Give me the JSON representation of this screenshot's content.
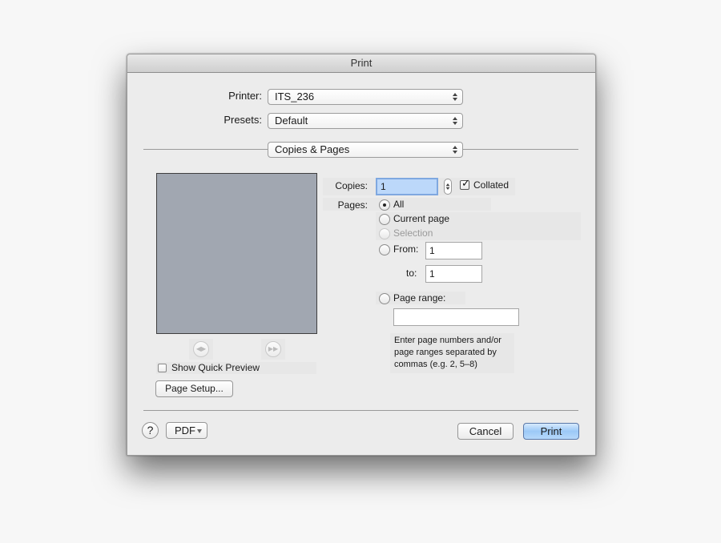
{
  "window": {
    "title": "Print"
  },
  "printer": {
    "label": "Printer:",
    "value": "ITS_236"
  },
  "presets": {
    "label": "Presets:",
    "value": "Default"
  },
  "section": {
    "value": "Copies & Pages"
  },
  "copies": {
    "label": "Copies:",
    "value": "1",
    "collated_label": "Collated",
    "collated": true
  },
  "pages": {
    "label": "Pages:",
    "options": [
      {
        "label": "All",
        "selected": true,
        "enabled": true
      },
      {
        "label": "Current page",
        "selected": false,
        "enabled": true
      },
      {
        "label": "Selection",
        "selected": false,
        "enabled": false
      },
      {
        "label": "From:",
        "selected": false,
        "enabled": true
      },
      {
        "label": "Page range:",
        "selected": false,
        "enabled": true
      }
    ],
    "from_value": "1",
    "to_label": "to:",
    "to_value": "1",
    "range_value": "",
    "hint": [
      "Enter page numbers and/or",
      "page ranges separated by",
      "commas (e.g. 2, 5–8)"
    ]
  },
  "preview": {
    "show_quick_preview_label": "Show Quick Preview",
    "show_quick_preview": false,
    "prev_icon": "prev-page-icon",
    "next_icon": "next-page-icon"
  },
  "buttons": {
    "page_setup": "Page Setup...",
    "help": "?",
    "pdf": "PDF",
    "cancel": "Cancel",
    "print": "Print"
  }
}
